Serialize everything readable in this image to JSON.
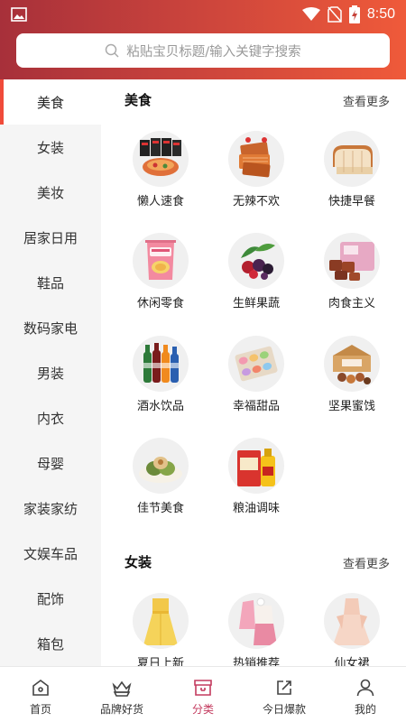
{
  "status_bar": {
    "time": "8:50",
    "icons": [
      "image-icon",
      "wifi-icon",
      "no-sim-icon",
      "battery-charging-icon"
    ]
  },
  "search": {
    "placeholder": "粘贴宝贝标题/输入关键字搜索",
    "icon": "search-icon"
  },
  "sidebar": {
    "items": [
      {
        "label": "美食",
        "active": true
      },
      {
        "label": "女装"
      },
      {
        "label": "美妆"
      },
      {
        "label": "居家日用"
      },
      {
        "label": "鞋品"
      },
      {
        "label": "数码家电"
      },
      {
        "label": "男装"
      },
      {
        "label": "内衣"
      },
      {
        "label": "母婴"
      },
      {
        "label": "家装家纺"
      },
      {
        "label": "文娱车品"
      },
      {
        "label": "配饰"
      },
      {
        "label": "箱包"
      }
    ]
  },
  "sections": [
    {
      "title": "美食",
      "more": "查看更多",
      "items": [
        {
          "label": "懒人速食",
          "icon": "instant-noodles-icon"
        },
        {
          "label": "无辣不欢",
          "icon": "spicy-snack-icon"
        },
        {
          "label": "快捷早餐",
          "icon": "bread-icon"
        },
        {
          "label": "休闲零食",
          "icon": "snack-bag-icon"
        },
        {
          "label": "生鲜果蔬",
          "icon": "fruit-icon"
        },
        {
          "label": "肉食主义",
          "icon": "meat-icon"
        },
        {
          "label": "酒水饮品",
          "icon": "drinks-icon"
        },
        {
          "label": "幸福甜品",
          "icon": "macaron-icon"
        },
        {
          "label": "坚果蜜饯",
          "icon": "nuts-icon"
        },
        {
          "label": "佳节美食",
          "icon": "rice-cake-icon"
        },
        {
          "label": "粮油调味",
          "icon": "rice-oil-icon"
        }
      ]
    },
    {
      "title": "女装",
      "more": "查看更多",
      "items": [
        {
          "label": "夏日上新",
          "icon": "yellow-dress-icon"
        },
        {
          "label": "热销推荐",
          "icon": "pink-outfit-icon"
        },
        {
          "label": "仙女裙",
          "icon": "lace-dress-icon"
        }
      ]
    }
  ],
  "tabbar": {
    "items": [
      {
        "label": "首页",
        "icon": "home-icon"
      },
      {
        "label": "品牌好货",
        "icon": "crown-basket-icon"
      },
      {
        "label": "分类",
        "icon": "category-icon",
        "active": true
      },
      {
        "label": "今日爆款",
        "icon": "share-icon"
      },
      {
        "label": "我的",
        "icon": "user-icon"
      }
    ]
  }
}
